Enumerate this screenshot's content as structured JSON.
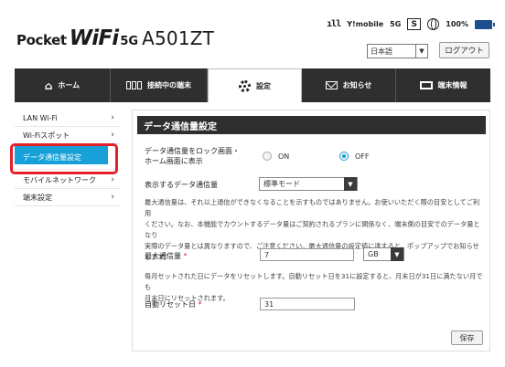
{
  "header": {
    "logo_pocket": "Pocket",
    "logo_wifi": "WiFi",
    "logo_5g": "5G",
    "logo_model": "A501ZT",
    "signal": "᷊ıl",
    "carrier": "Y!mobile",
    "network": "5G",
    "sim_label": "S",
    "battery_percent": "100%",
    "language_value": "日本語",
    "logout_label": "ログアウト"
  },
  "nav": {
    "tabs": [
      {
        "label": "ホーム",
        "icon": "home-icon"
      },
      {
        "label": "接続中の端末",
        "icon": "connected-devices-icon"
      },
      {
        "label": "設定",
        "icon": "gear-icon"
      },
      {
        "label": "お知らせ",
        "icon": "mail-icon"
      },
      {
        "label": "端末情報",
        "icon": "device-info-icon"
      }
    ],
    "active_tab": "設定"
  },
  "sidebar": {
    "items": [
      {
        "label": "LAN Wi-Fi"
      },
      {
        "label": "Wi-Fiスポット"
      },
      {
        "label": "データ通信量設定"
      },
      {
        "label": "モバイルネットワーク"
      },
      {
        "label": "端末設定"
      }
    ],
    "selected": "データ通信量設定",
    "highlight_color": "#e5202b",
    "selected_bg": "#18a1d8"
  },
  "panel": {
    "title": "データ通信量設定",
    "lock_label_line1": "データ通信量をロック画面・",
    "lock_label_line2": "ホーム画面に表示",
    "radio_on_label": "ON",
    "radio_off_label": "OFF",
    "radio_selected": "OFF",
    "display_label": "表示するデータ通信量",
    "display_value": "標準モード",
    "note1_line1": "最大通信量は、それ以上通信ができなくなることを示すものではありません。お使いいただく際の目安としてご利用",
    "note1_line2": "ください。なお、本機能でカウントするデータ量はご契約されるプランに関係なく、端末側の目安でのデータ量となり",
    "note1_line3": "実際のデータ量とは異なりますので、ご注意ください。最大通信量の設定値に達すると、ポップアップでお知らせ",
    "note1_line4": "します。",
    "max_label": "最大通信量",
    "max_value": "7",
    "unit_value": "GB",
    "note2_line1": "毎月セットされた日にデータをリセットします。自動リセット日を31に設定すると、月末日が31日に満たない月でも",
    "note2_line2": "月末日にリセットされます。",
    "reset_label": "自動リセット日",
    "reset_value": "31",
    "required_mark": "*",
    "save_label": "保存"
  }
}
